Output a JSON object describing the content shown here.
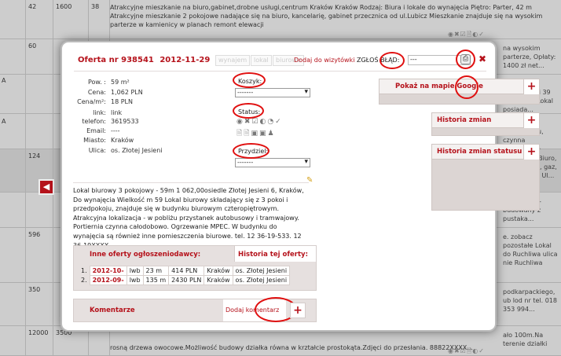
{
  "background": {
    "rows": [
      {
        "c1": "42",
        "c2": "1600",
        "c3": "38",
        "desc": "Atrakcyjne mieszkanie na biuro,gabinet,drobne usługi,centrum Kraków Kraków Rodzaj: Biura i lokale do wynajęcia Piętro: Parter, 42 m Atrakcyjne mieszkanie 2 pokojowe nadające się na biuro, kancelarię, gabinet przecznica od ul.Lubicz Mieszkanie znajduje się na wysokim parterze w kamienicy w planach remont elewacji"
      },
      {
        "c1": "60",
        "c2": "",
        "c3": "",
        "desc": "",
        "right": "na wysokim parterze, Opłaty: 1400 zł net..."
      },
      {
        "c1": "",
        "c2": "",
        "c3": "",
        "desc": "",
        "right": "y lokal o powierzchni 39 ybickiego. Lokal posiada..."
      },
      {
        "c1": "",
        "c2": "",
        "c3": "",
        "desc": "",
        "right": "3 pokoi i przedpokoju, czynna całodobowo."
      },
      {
        "c1": "124",
        "c2": "",
        "c3": "",
        "desc": "",
        "right": "znaczenie: Biuro, zwykłe ogła, gaz, kanalizacja, Ul..."
      },
      {
        "c1": "",
        "c2": "",
        "c3": "",
        "desc": "",
        "right": "PRZEDANIA- budowany z pustaka..."
      },
      {
        "c1": "596",
        "c2": "",
        "c3": "",
        "desc": "",
        "right": "e. zobacz pozostałe Lokal do Ruchliwa ulica nie Ruchliwa"
      },
      {
        "c1": "350",
        "c2": "",
        "c3": "",
        "desc": "",
        "right": "podkarpackiego, ub lod nr tel. 018 353 994..."
      },
      {
        "c1": "12000",
        "c2": "3500",
        "c3": "",
        "desc": "rosną drzewa owocowe.Możliwość budowy działka równa w krztałcie prostokąta.Zdjęci do przesłania. 88822XXXX...",
        "right": "ało 100m.Na terenie działki"
      }
    ],
    "leftChar": "A",
    "icons": "◉✖☑🗎◐✓"
  },
  "dialog": {
    "offer_label": "Oferta nr 938541",
    "offer_date": "2012-11-29",
    "buttons": {
      "wynajem": "wynajem",
      "lokal": "lokal",
      "biurowe": "biurowe"
    },
    "add_to_all": "Dodaj do wizytówki",
    "report_error": "ZGŁOŚ BŁĄD:",
    "report_value": "---",
    "fields": {
      "pow_label": "Pow. :",
      "pow_value": "59 m²",
      "cena_label": "Cena:",
      "cena_value": "1,062 PLN",
      "cenam_label": "Cena/m²:",
      "cenam_value": "18 PLN",
      "link_label": "link:",
      "link_value": "link",
      "telefon_label": "telefon:",
      "telefon_value": "3619533",
      "email_label": "Email:",
      "email_value": "----",
      "miasto_label": "Miasto:",
      "miasto_value": "Kraków",
      "ulica_label": "Ulica:",
      "ulica_value": "os. Złotej Jesieni"
    },
    "koszyk_label": "Koszyk:",
    "koszyk_value": "-------",
    "status_label": "Status:",
    "przydziel_label": "Przydziel:",
    "przydziel_value": "-------",
    "panels": {
      "map": "Pokaż na mapie Google",
      "history": "Historia zmian",
      "status_history": "Historia zmian statusu"
    },
    "description": "Lokal biurowy 3 pokojowy - 59m  1 062,00osiedle Złotej Jesieni 6, Kraków, Do wynajęcia Wielkość m 59 Lokal biurowy składający się z 3 pokoi i przedpokoju, znajduje się w budynku biurowym czteropiętrowym. Atrakcyjna lokalizacja - w pobliżu przystanek autobusowy i tramwajowy. Portiernia czynna całodobowo. Ogrzewanie MPEC. W budynku do wynajęcia są również inne pomieszczenia biurowe. tel. 12 36-19-533. 12 36-19XXXX",
    "tabs": {
      "other_offers": "Inne oferty ogłoszeniodawcy:",
      "history": "Historia tej oferty:"
    },
    "offers": [
      {
        "n": "1.",
        "date": "2012-10-",
        "type": "lwb",
        "size": "23 m",
        "price": "414 PLN",
        "city": "Kraków",
        "street": "os. Złotej Jesieni"
      },
      {
        "n": "2.",
        "date": "2012-09-",
        "type": "lwb",
        "size": "135 m",
        "price": "2430 PLN",
        "city": "Kraków",
        "street": "os. Złotej Jesieni"
      }
    ],
    "comments_label": "Komentarze",
    "add_comment_label": "Dodaj komentarz"
  }
}
